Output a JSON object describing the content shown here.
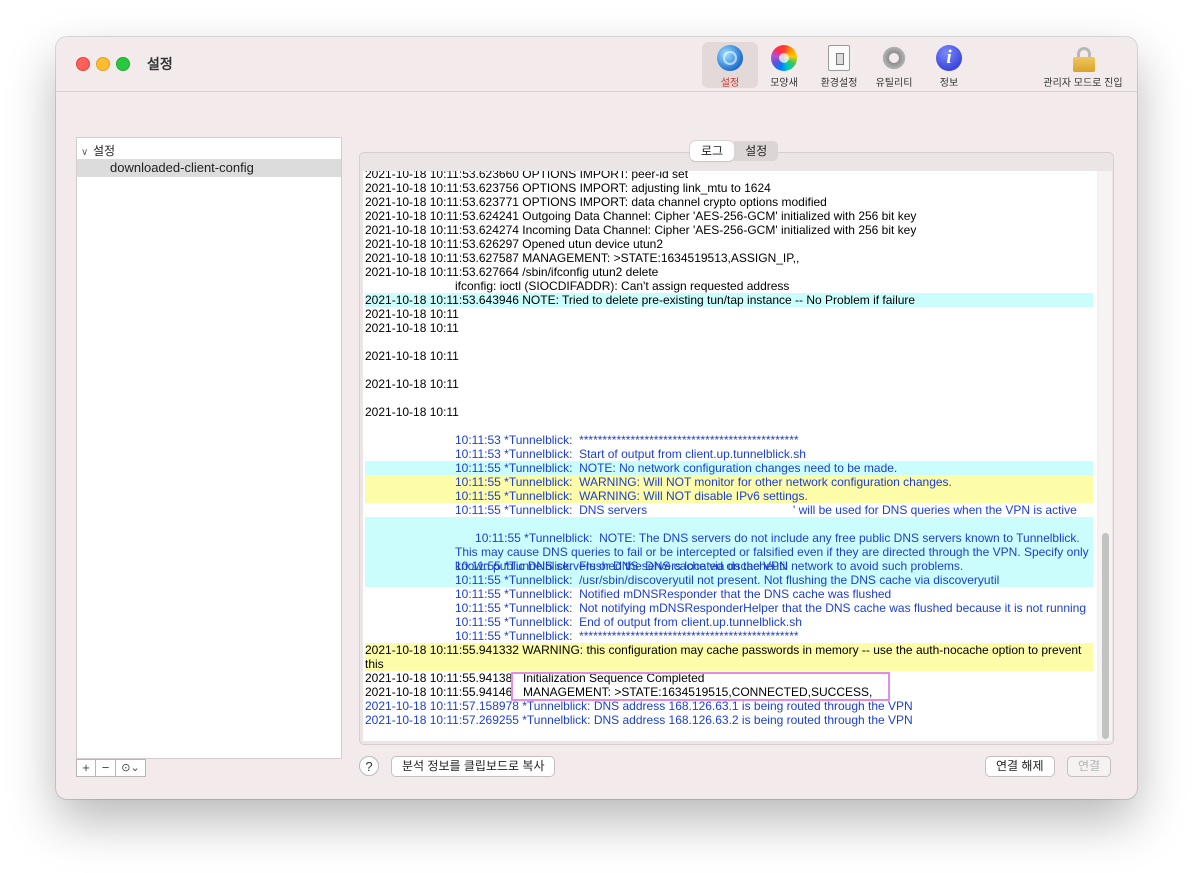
{
  "window": {
    "title": "설정"
  },
  "toolbar": {
    "items": [
      {
        "label": "설정",
        "icon": "globe-icon"
      },
      {
        "label": "모양새",
        "icon": "color-wheel-icon"
      },
      {
        "label": "환경설정",
        "icon": "switch-icon"
      },
      {
        "label": "유틸리티",
        "icon": "gear-icon"
      },
      {
        "label": "정보",
        "icon": "info-icon",
        "glyph": "i"
      }
    ],
    "admin_label": "관리자 모드로 진입"
  },
  "sidebar": {
    "group_label": "설정",
    "item_label": "downloaded-client-config",
    "buttons": {
      "add": "+",
      "remove": "−",
      "more": "⊙⌄"
    }
  },
  "tabs": {
    "log": "로그",
    "settings": "설정"
  },
  "log": {
    "lines": [
      "2021-10-18 10:11:53.623660 OPTIONS IMPORT: peer-id set",
      "2021-10-18 10:11:53.623756 OPTIONS IMPORT: adjusting link_mtu to 1624",
      "2021-10-18 10:11:53.623771 OPTIONS IMPORT: data channel crypto options modified",
      "2021-10-18 10:11:53.624241 Outgoing Data Channel: Cipher 'AES-256-GCM' initialized with 256 bit key",
      "2021-10-18 10:11:53.624274 Incoming Data Channel: Cipher 'AES-256-GCM' initialized with 256 bit key",
      "2021-10-18 10:11:53.626297 Opened utun device utun2",
      "2021-10-18 10:11:53.627587 MANAGEMENT: >STATE:1634519513,ASSIGN_IP,,",
      "2021-10-18 10:11:53.627664 /sbin/ifconfig utun2 delete",
      "ifconfig: ioctl (SIOCDIFADDR): Can't assign requested address",
      "2021-10-18 10:11:53.643946 NOTE: Tried to delete pre-existing tun/tap instance -- No Problem if failure",
      "2021-10-18 10:11",
      "2021-10-18 10:11",
      "2021-10-18 10:11",
      "2021-10-18 10:11",
      "2021-10-18 10:11",
      "10:11:53 *Tunnelblick:  ***********************************************",
      "10:11:53 *Tunnelblick:  Start of output from client.up.tunnelblick.sh",
      "10:11:55 *Tunnelblick:  NOTE: No network configuration changes need to be made.",
      "10:11:55 *Tunnelblick:  WARNING: Will NOT monitor for other network configuration changes.",
      "10:11:55 *Tunnelblick:  WARNING: Will NOT disable IPv6 settings.",
      "10:11:55 *Tunnelblick:  DNS servers",
      "' will be used for DNS queries when the VPN is active",
      "10:11:55 *Tunnelblick:  NOTE: The DNS servers do not include any free public DNS servers known to Tunnelblick. This may cause DNS queries to fail or be intercepted or falsified even if they are directed through the VPN. Specify only known public DNS servers or DNS servers located on the VPN network to avoid such problems.",
      "10:11:55 *Tunnelblick:  Flushed the DNS cache via dscacheutil",
      "10:11:55 *Tunnelblick:  /usr/sbin/discoveryutil not present. Not flushing the DNS cache via discoveryutil",
      "10:11:55 *Tunnelblick:  Notified mDNSResponder that the DNS cache was flushed",
      "10:11:55 *Tunnelblick:  Not notifying mDNSResponderHelper that the DNS cache was flushed because it is not running",
      "10:11:55 *Tunnelblick:  End of output from client.up.tunnelblick.sh",
      "10:11:55 *Tunnelblick:  ***********************************************",
      "2021-10-18 10:11:55.941332 WARNING: this configuration may cache passwords in memory -- use the auth-nocache option to prevent this",
      "2021-10-18 10:11:55.94138",
      "Initialization Sequence Completed",
      "2021-10-18 10:11:55.94146",
      "MANAGEMENT: >STATE:1634519515,CONNECTED,SUCCESS,",
      "2021-10-18 10:11:57.158978 *Tunnelblick: DNS address 168.126.63.1 is being routed through the VPN",
      "2021-10-18 10:11:57.269255 *Tunnelblick: DNS address 168.126.63.2 is being routed through the VPN"
    ]
  },
  "bottom": {
    "help": "?",
    "copy_diagnostics": "분석 정보를 클립보드로 복사",
    "disconnect": "연결 해제",
    "connect": "연결"
  },
  "colors": {
    "log_blue": "#1c3fd1",
    "highlight_cyan": "#cbfdfd",
    "highlight_yellow": "#fcfca9",
    "highlight_box": "#e48ae7"
  }
}
